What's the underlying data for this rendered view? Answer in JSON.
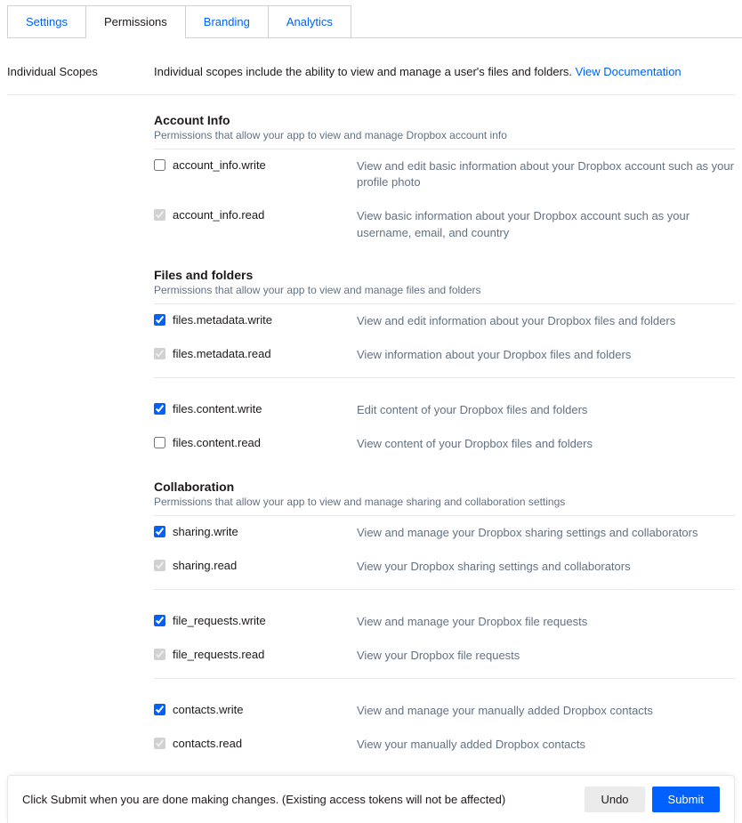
{
  "tabs": {
    "settings": "Settings",
    "permissions": "Permissions",
    "branding": "Branding",
    "analytics": "Analytics"
  },
  "scopes": {
    "label": "Individual Scopes",
    "desc": "Individual scopes include the ability to view and manage a user's files and folders. ",
    "link": "View Documentation"
  },
  "groups": {
    "account": {
      "title": "Account Info",
      "desc": "Permissions that allow your app to view and manage Dropbox account info",
      "items": {
        "write": {
          "name": "account_info.write",
          "desc": "View and edit basic information about your Dropbox account such as your profile photo"
        },
        "read": {
          "name": "account_info.read",
          "desc": "View basic information about your Dropbox account such as your username, email, and country"
        }
      }
    },
    "files": {
      "title": "Files and folders",
      "desc": "Permissions that allow your app to view and manage files and folders",
      "meta_write": {
        "name": "files.metadata.write",
        "desc": "View and edit information about your Dropbox files and folders"
      },
      "meta_read": {
        "name": "files.metadata.read",
        "desc": "View information about your Dropbox files and folders"
      },
      "content_write": {
        "name": "files.content.write",
        "desc": "Edit content of your Dropbox files and folders"
      },
      "content_read": {
        "name": "files.content.read",
        "desc": "View content of your Dropbox files and folders"
      }
    },
    "collab": {
      "title": "Collaboration",
      "desc": "Permissions that allow your app to view and manage sharing and collaboration settings",
      "sharing_write": {
        "name": "sharing.write",
        "desc": "View and manage your Dropbox sharing settings and collaborators"
      },
      "sharing_read": {
        "name": "sharing.read",
        "desc": "View your Dropbox sharing settings and collaborators"
      },
      "freq_write": {
        "name": "file_requests.write",
        "desc": "View and manage your Dropbox file requests"
      },
      "freq_read": {
        "name": "file_requests.read",
        "desc": "View your Dropbox file requests"
      },
      "contacts_write": {
        "name": "contacts.write",
        "desc": "View and manage your manually added Dropbox contacts"
      },
      "contacts_read": {
        "name": "contacts.read",
        "desc": "View your manually added Dropbox contacts"
      }
    }
  },
  "footer": {
    "text": "Click Submit when you are done making changes. (Existing access tokens will not be affected)",
    "undo": "Undo",
    "submit": "Submit"
  }
}
